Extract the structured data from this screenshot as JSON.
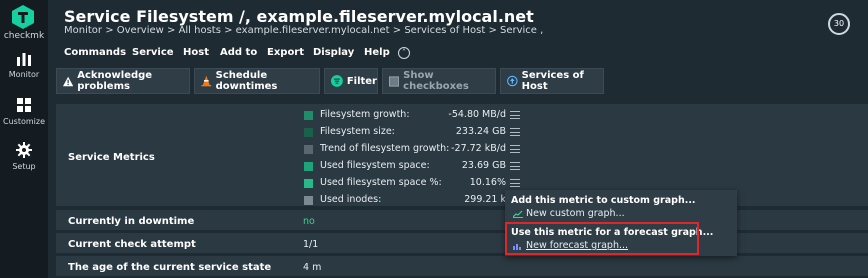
{
  "app": {
    "logo_label": "checkmk",
    "nav": [
      {
        "label": "Monitor",
        "icon": "bar-chart-icon"
      },
      {
        "label": "Customize",
        "icon": "grid-icon"
      },
      {
        "label": "Setup",
        "icon": "gear-icon"
      }
    ]
  },
  "header": {
    "title": "Service Filesystem /, example.fileserver.mylocal.net",
    "breadcrumb": "Monitor > Overview > All hosts > example.fileserver.mylocal.net > Services of Host > Service ,",
    "refresh_seconds": "30"
  },
  "menubar": {
    "items": [
      "Commands",
      "Service",
      "Host",
      "Add to",
      "Export",
      "Display",
      "Help"
    ],
    "toggle_icon": "chevron-up-icon"
  },
  "toolbar": {
    "acknowledge": "Acknowledge problems",
    "schedule": "Schedule downtimes",
    "filter": "Filter",
    "show_checkboxes": "Show checkboxes",
    "services_of_host": "Services of Host"
  },
  "table": {
    "service_metrics_label": "Service Metrics",
    "metrics": [
      {
        "name": "Filesystem growth:",
        "value": "-54.80 MB/d",
        "color": "#1f8c6a"
      },
      {
        "name": "Filesystem size:",
        "value": "233.24 GB",
        "color": "#1b5f4d"
      },
      {
        "name": "Trend of filesystem growth:",
        "value": "-27.72 kB/d",
        "color": "#5a6670"
      },
      {
        "name": "Used filesystem space:",
        "value": "23.69 GB",
        "color": "#1fa37a"
      },
      {
        "name": "Used filesystem space %:",
        "value": "10.16%",
        "color": "#27b986"
      },
      {
        "name": "Used inodes:",
        "value": "299.21 k",
        "color": "#7a8a93"
      }
    ],
    "rows": [
      {
        "key": "Currently in downtime",
        "value": "no"
      },
      {
        "key": "Current check attempt",
        "value": "1/1"
      },
      {
        "key": "The age of the current service state",
        "value": "4 m"
      }
    ]
  },
  "popup": {
    "custom_heading": "Add this metric to custom graph...",
    "custom_link": "New custom graph...",
    "forecast_heading": "Use this metric for a forecast graph...",
    "forecast_link": "New forecast graph..."
  },
  "colors": {
    "highlight": "#e0252b",
    "accent_green": "#3fcf8e",
    "background": "#1f2b33"
  }
}
